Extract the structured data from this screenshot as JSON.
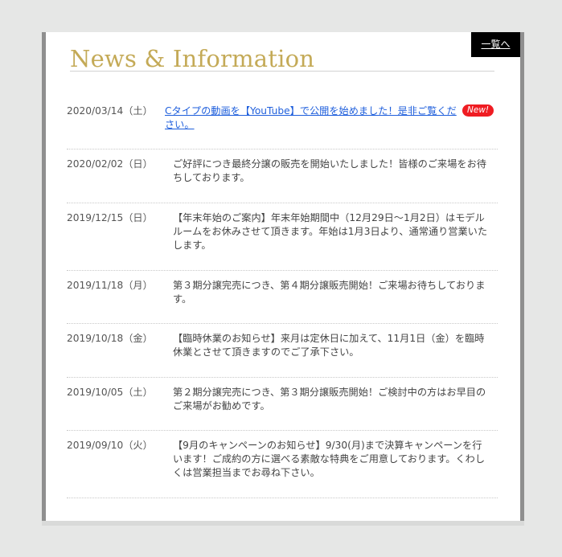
{
  "header": {
    "title": "News & Information",
    "list_link": "一覧へ"
  },
  "news": [
    {
      "date": "2020/03/14（土）",
      "text": "Cタイプの動画を【YouTube】で公開を始めました！是非ご覧ください。",
      "badge": "New!",
      "is_link": true
    },
    {
      "date": "2020/02/02（日）",
      "text": "ご好評につき最終分譲の販売を開始いたしました！皆様のご来場をお待ちしております。"
    },
    {
      "date": "2019/12/15（日）",
      "text": "【年末年始のご案内】年末年始期間中（12月29日～1月2日）はモデルルームをお休みさせて頂きます。年始は1月3日より、通常通り営業いたします。"
    },
    {
      "date": "2019/11/18（月）",
      "text": "第３期分譲完売につき、第４期分譲販売開始！ご来場お待ちしております。"
    },
    {
      "date": "2019/10/18（金）",
      "text": "【臨時休業のお知らせ】来月は定休日に加えて、11月1日（金）を臨時休業とさせて頂きますのでご了承下さい。"
    },
    {
      "date": "2019/10/05（土）",
      "text": "第２期分譲完売につき、第３期分譲販売開始！ご検討中の方はお早目のご来場がお勧めです。"
    },
    {
      "date": "2019/09/10（火）",
      "text": "【9月のキャンペーンのお知らせ】9/30(月)まで決算キャンペーンを行います！ご成約の方に選べる素敵な特典をご用意しております。くわしくは営業担当までお尋ね下さい。"
    }
  ]
}
